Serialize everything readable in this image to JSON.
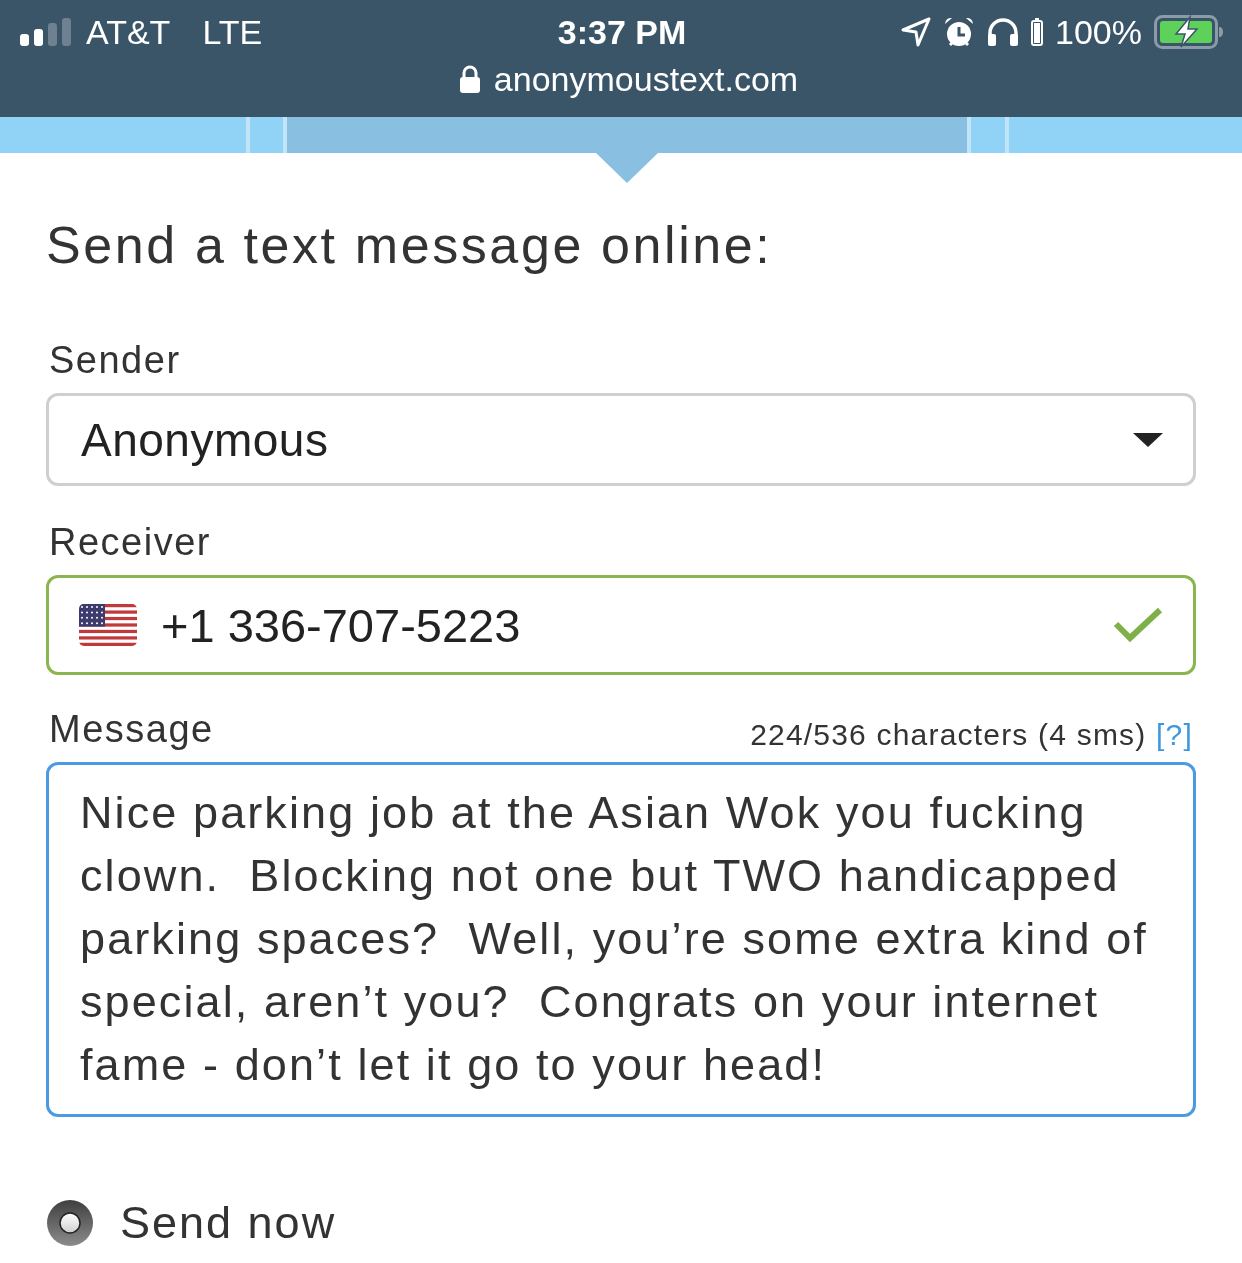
{
  "status_bar": {
    "carrier": "AT&T",
    "network": "LTE",
    "time": "3:37 PM",
    "battery": "100%"
  },
  "address_bar": {
    "url": "anonymoustext.com"
  },
  "nav_tabs": [
    {
      "selected": false
    },
    {
      "selected": false
    },
    {
      "selected": true
    },
    {
      "selected": false
    },
    {
      "selected": false
    }
  ],
  "form": {
    "title": "Send a text message online:",
    "sender": {
      "label": "Sender",
      "value": "Anonymous"
    },
    "receiver": {
      "label": "Receiver",
      "value": "+1 336-707-5223",
      "valid": true
    },
    "message": {
      "label": "Message",
      "counter": "224/536 characters (4 sms)",
      "help_link": "[?]",
      "focused": true,
      "value": "Nice parking job at the Asian Wok you fucking clown.  Blocking not one but TWO handicapped parking spaces?  Well, you’re some extra kind of special, aren’t you?  Congrats on your internet fame - don’t let it go to your head!"
    },
    "schedule": [
      {
        "label": "Send now",
        "selected": true
      }
    ]
  }
}
